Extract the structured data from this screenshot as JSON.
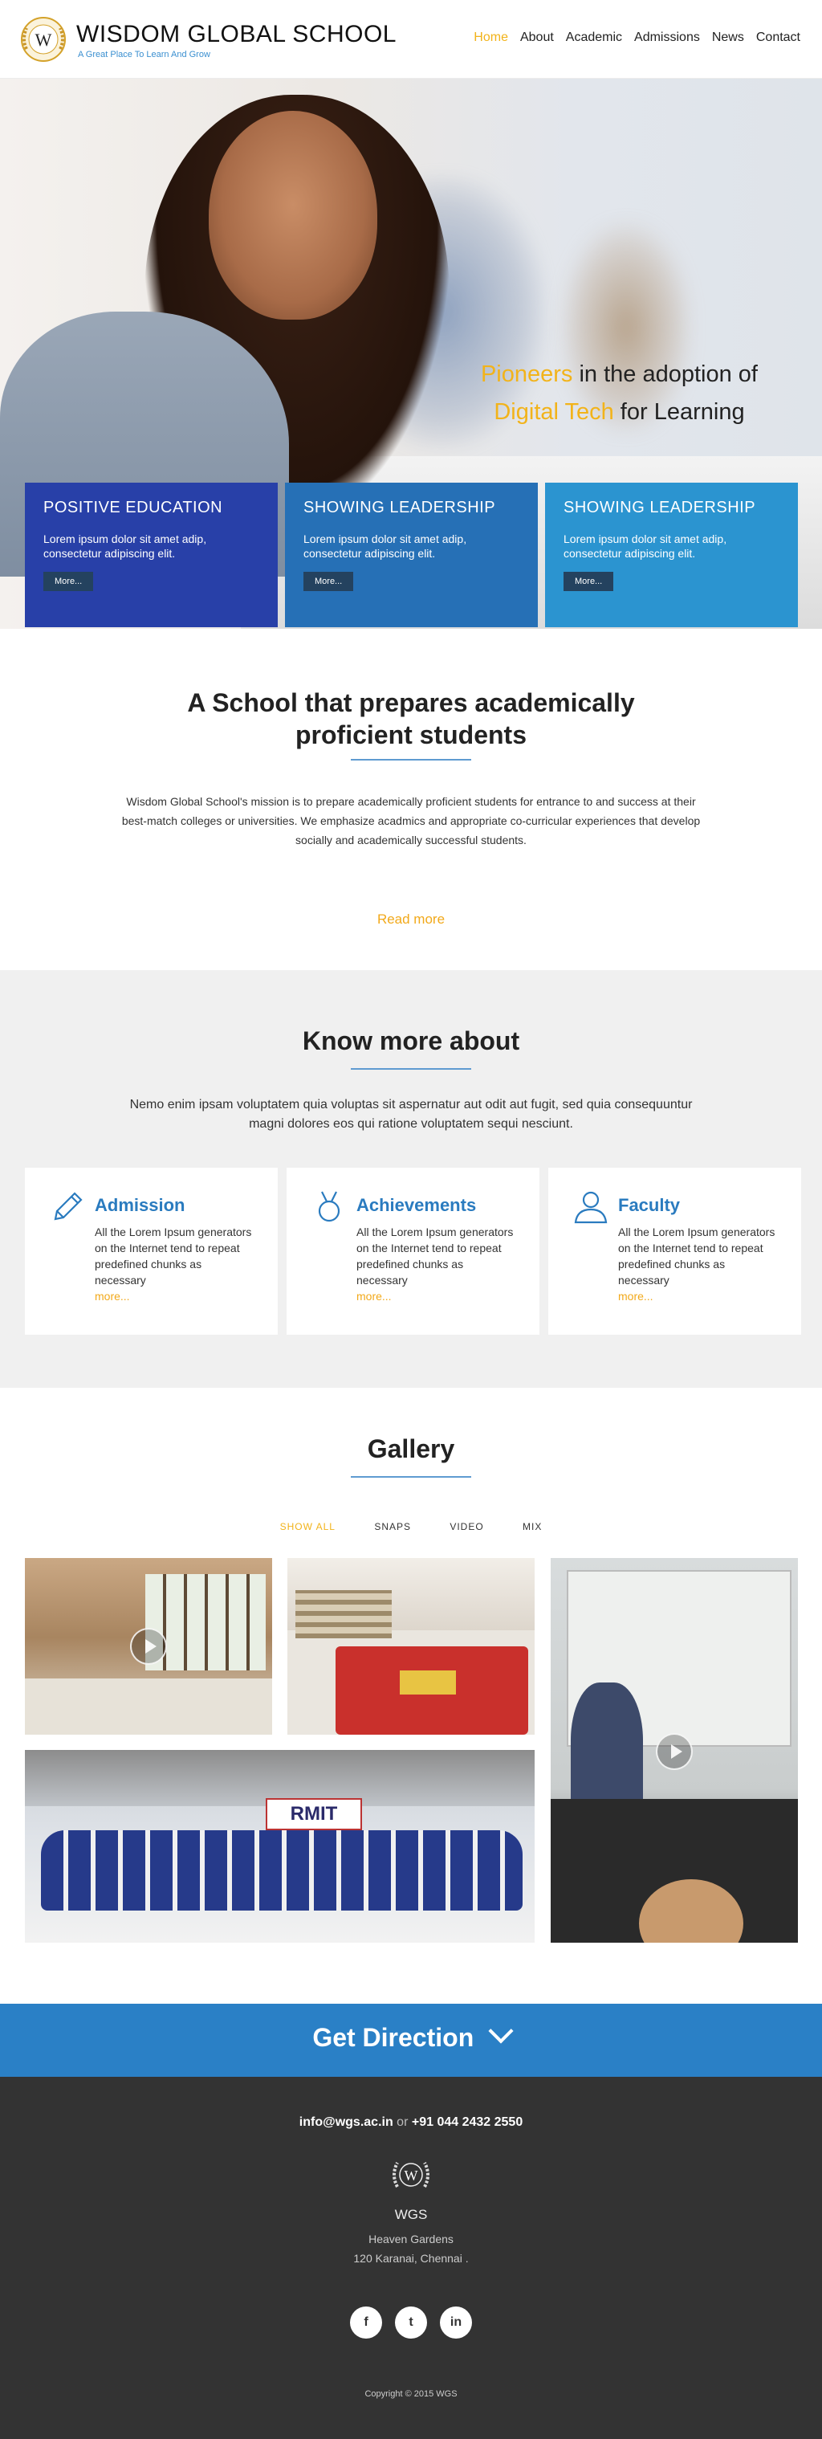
{
  "header": {
    "logo_letter": "W",
    "brand_name": "WISDOM GLOBAL SCHOOL",
    "tagline": "A Great Place To Learn And Grow",
    "nav": [
      {
        "label": "Home",
        "active": true
      },
      {
        "label": "About",
        "active": false
      },
      {
        "label": "Academic",
        "active": false
      },
      {
        "label": "Admissions",
        "active": false
      },
      {
        "label": "News",
        "active": false
      },
      {
        "label": "Contact",
        "active": false
      }
    ]
  },
  "hero": {
    "headline_line1_accent": "Pioneers",
    "headline_line1_rest": " in the adoption of",
    "headline_line2_accent": "Digital Tech",
    "headline_line2_rest": " for Learning",
    "cards": [
      {
        "title": "POSITIVE EDUCATION",
        "text": "Lorem ipsum dolor sit amet adip, consectetur adipiscing elit.",
        "button": "More..."
      },
      {
        "title": "SHOWING  LEADERSHIP",
        "text": "Lorem ipsum dolor sit amet adip, consectetur adipiscing elit.",
        "button": "More..."
      },
      {
        "title": "SHOWING  LEADERSHIP",
        "text": "Lorem ipsum dolor sit amet adip, consectetur adipiscing elit.",
        "button": "More..."
      }
    ]
  },
  "intro": {
    "title_line1": "A School that prepares academically",
    "title_line2": "proficient students",
    "text": "Wisdom Global School's mission is to prepare academically proficient students for entrance to and success at their best-match colleges or universities. We emphasize acadmics and appropriate co-curricular experiences that develop socially and academically successful students.",
    "read_more": "Read more"
  },
  "know_more": {
    "title": "Know more about",
    "subtitle": "Nemo enim ipsam voluptatem quia voluptas sit aspernatur aut odit aut fugit, sed quia consequuntur magni dolores eos qui ratione voluptatem sequi nesciunt.",
    "features": [
      {
        "icon": "pencil-icon",
        "title": "Admission",
        "text": "All the Lorem Ipsum generators on the Internet tend to repeat predefined chunks as necessary",
        "more": "more..."
      },
      {
        "icon": "medal-icon",
        "title": "Achievements",
        "text": "All the Lorem Ipsum generators on the Internet tend to repeat predefined chunks as necessary",
        "more": "more..."
      },
      {
        "icon": "user-icon",
        "title": "Faculty",
        "text": "All the Lorem Ipsum generators on the Internet tend to repeat predefined chunks as necessary",
        "more": "more..."
      }
    ]
  },
  "gallery": {
    "title": "Gallery",
    "filters": [
      {
        "label": "SHOW ALL",
        "active": true
      },
      {
        "label": "SNAPS",
        "active": false
      },
      {
        "label": "VIDEO",
        "active": false
      },
      {
        "label": "MIX",
        "active": false
      }
    ],
    "banner_text": "RMIT"
  },
  "direction": {
    "label": "Get Direction"
  },
  "footer": {
    "email": "info@wgs.ac.in",
    "or": " or ",
    "phone": "+91 044 2432 2550",
    "logo_letter": "W",
    "name": "WGS",
    "address_line1": "Heaven Gardens",
    "address_line2": "120 Karanai, Chennai .",
    "socials": [
      {
        "icon": "facebook-icon",
        "glyph": "f"
      },
      {
        "icon": "twitter-icon",
        "glyph": "t"
      },
      {
        "icon": "linkedin-icon",
        "glyph": "in"
      }
    ],
    "copyright": "Copyright © 2015 WGS"
  },
  "colors": {
    "accent": "#f2b31a",
    "primary_blue": "#2a7bbf",
    "card1": "#2840a8",
    "card2": "#2670b6",
    "card3": "#2b94d0",
    "footer_bg": "#333333"
  }
}
